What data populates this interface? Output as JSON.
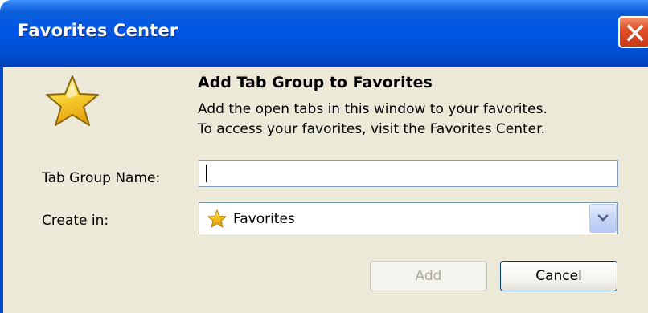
{
  "window": {
    "title": "Favorites Center",
    "close_icon": "close-icon"
  },
  "dialog": {
    "icon": "star-icon",
    "heading": "Add Tab Group to Favorites",
    "description": [
      "Add the open tabs in this window to your favorites.",
      "To access your favorites, visit the Favorites Center."
    ]
  },
  "form": {
    "name_label": "Tab Group Name:",
    "name_value": "",
    "create_in_label": "Create in:",
    "create_in_value": "Favorites",
    "create_in_icon": "star-icon",
    "dropdown_icon": "chevron-down-icon"
  },
  "buttons": {
    "add_label": "Add",
    "add_enabled": false,
    "cancel_label": "Cancel"
  },
  "colors": {
    "titlebar": "#0055e5",
    "client": "#ece9d8",
    "close_button": "#e0502a",
    "star": "#f7c81d"
  }
}
